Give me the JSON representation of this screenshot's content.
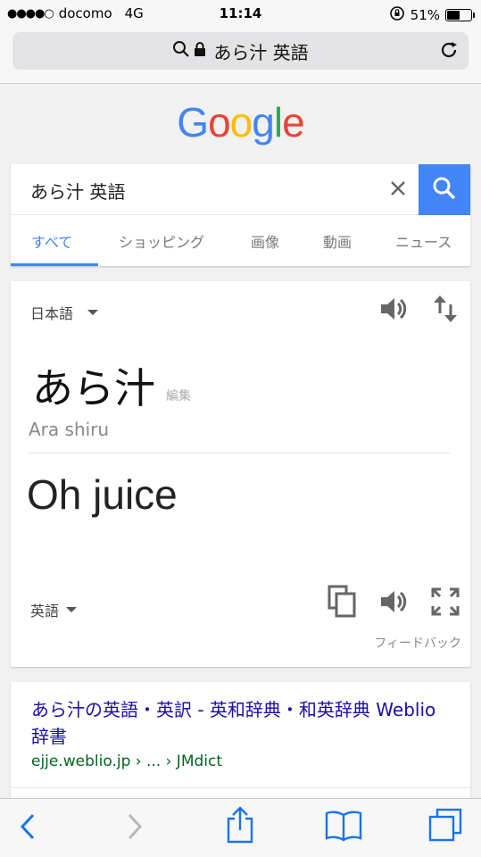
{
  "status": {
    "signal_dots": "●●●●○",
    "carrier": "docomo",
    "network": "4G",
    "time": "11:14",
    "battery": "51%",
    "battery_level": 0.51
  },
  "urlbar": {
    "text": "あら汁 英語"
  },
  "logo": [
    "G",
    "o",
    "o",
    "g",
    "l",
    "e"
  ],
  "search": {
    "query": "あら汁 英語",
    "tabs": [
      "すべて",
      "ショッピング",
      "画像",
      "動画",
      "ニュース"
    ],
    "active_tab": "すべて"
  },
  "translate": {
    "source_lang": "日本語",
    "source_text": "あら汁",
    "edit_label": "編集",
    "romanization": "Ara shiru",
    "translation": "Oh juice",
    "target_lang": "英語",
    "feedback": "フィードバック"
  },
  "result": {
    "title": "あら汁の英語・英訳 - 英和辞典・和英辞典 Weblio辞書",
    "url": "ejje.weblio.jp › ... › JMdict"
  },
  "colors": {
    "accent": "#4285f4",
    "link": "#1a0dab",
    "url_green": "#006621",
    "ios_blue": "#1a73e8"
  }
}
